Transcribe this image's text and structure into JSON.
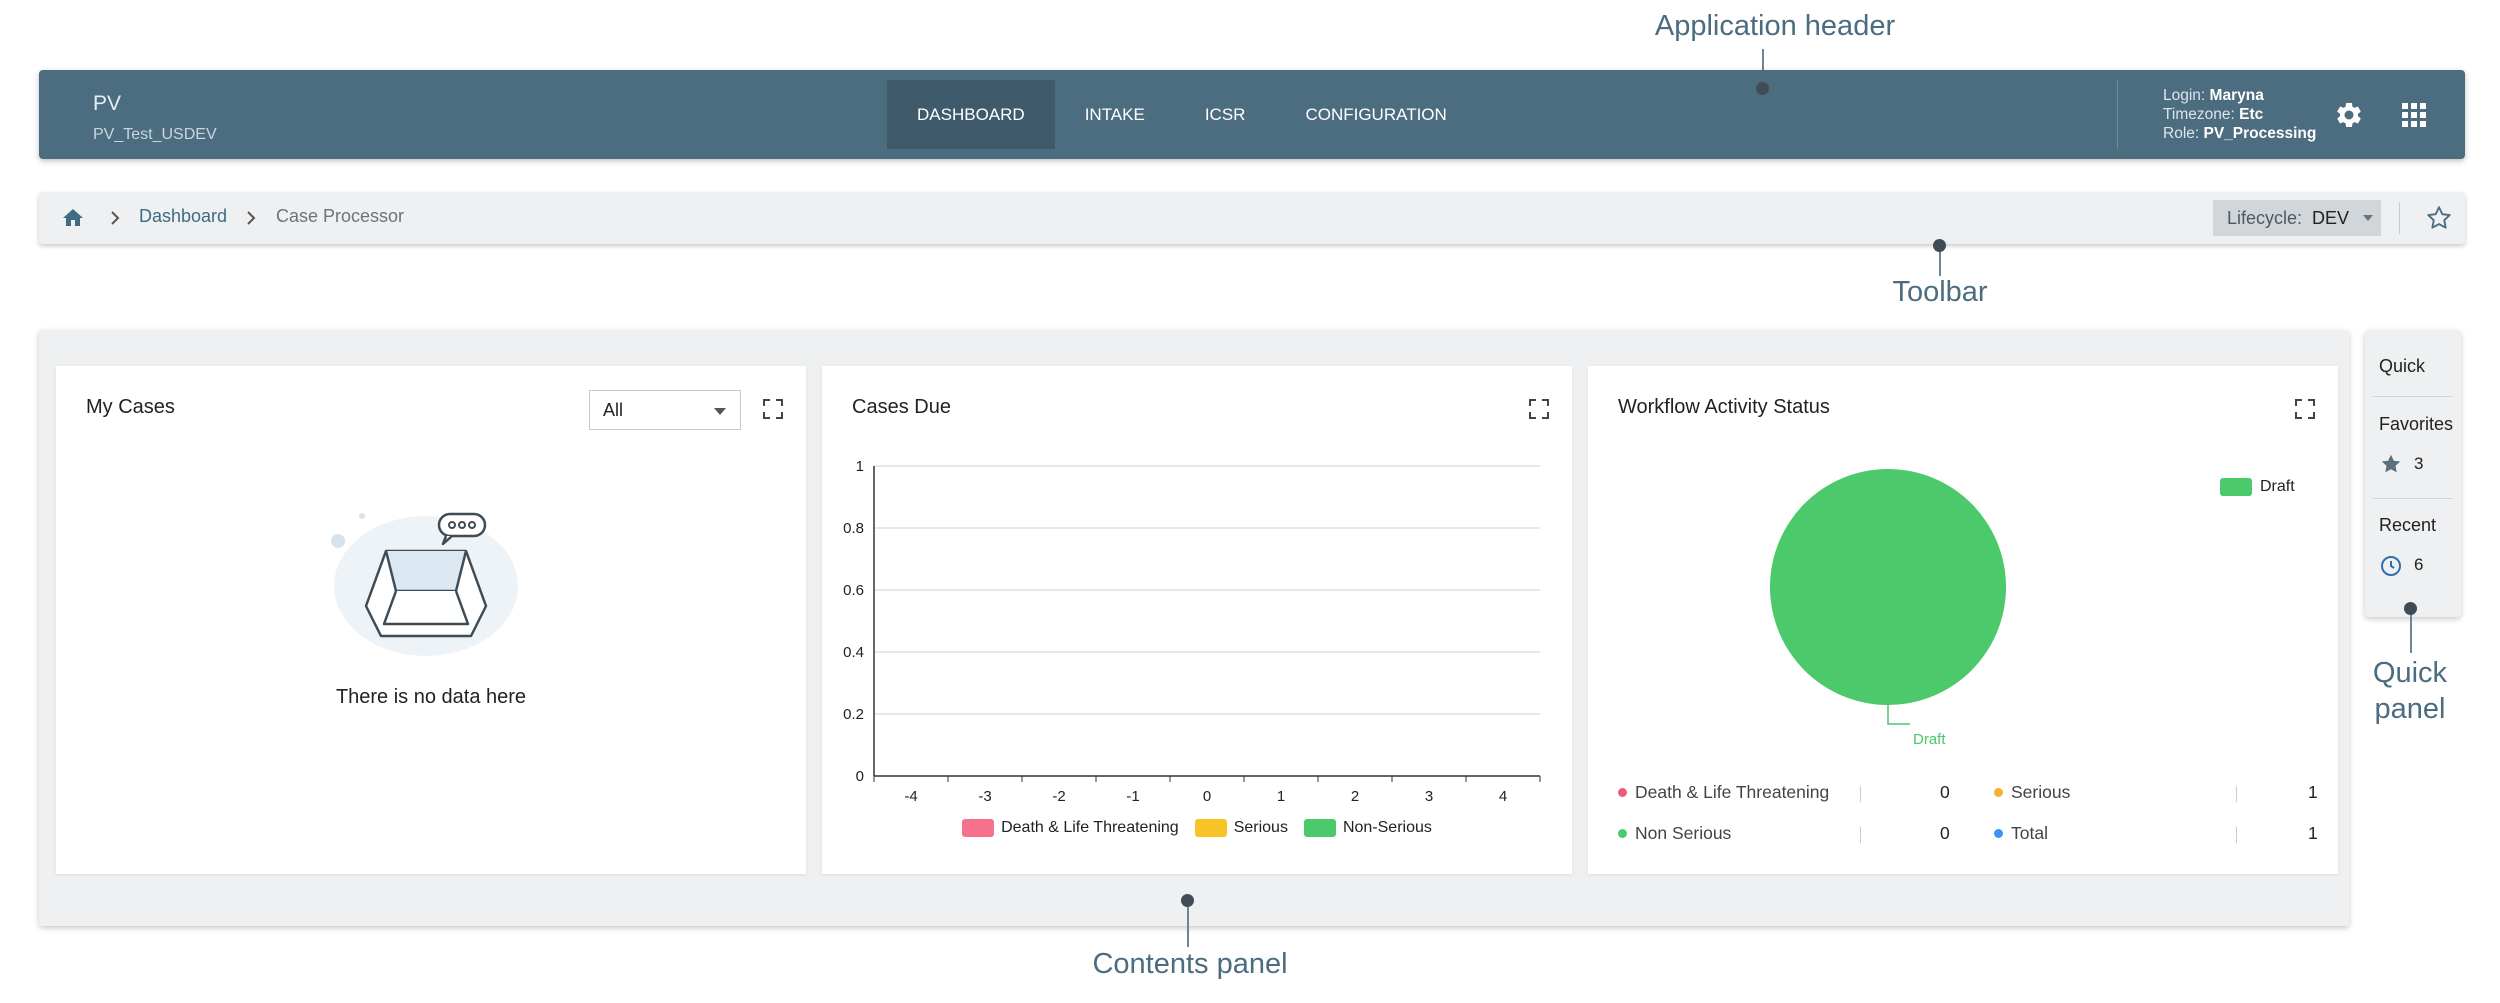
{
  "header": {
    "app_title": "PV",
    "app_subtitle": "PV_Test_USDEV",
    "nav_tabs": [
      {
        "label": "DASHBOARD",
        "active": true
      },
      {
        "label": "INTAKE",
        "active": false
      },
      {
        "label": "ICSR",
        "active": false
      },
      {
        "label": "CONFIGURATION",
        "active": false
      }
    ],
    "user": {
      "login_label": "Login:",
      "login_value": "Maryna",
      "timezone_label": "Timezone:",
      "timezone_value": "Etc",
      "role_label": "Role:",
      "role_value": "PV_Processing"
    },
    "icons": {
      "settings": "gear-icon",
      "apps": "grid-apps-icon"
    }
  },
  "toolbar": {
    "breadcrumbs": [
      {
        "label": "Dashboard",
        "link": true
      },
      {
        "label": "Case Processor",
        "link": false
      }
    ],
    "lifecycle_label": "Lifecycle:",
    "lifecycle_value": "DEV",
    "icons": {
      "home": "home-icon",
      "favorite": "star-outline-icon"
    }
  },
  "cards": {
    "my_cases": {
      "title": "My Cases",
      "filter_value": "All",
      "empty_text": "There is no data here"
    },
    "cases_due": {
      "title": "Cases Due"
    },
    "workflow": {
      "title": "Workflow Activity Status",
      "legend_label": "Draft",
      "pie_label": "Draft",
      "stats": [
        {
          "label": "Death & Life Threatening",
          "value": "0",
          "color": "#ef5a79"
        },
        {
          "label": "Serious",
          "value": "1",
          "color": "#f2b42a"
        },
        {
          "label": "Non Serious",
          "value": "0",
          "color": "#4bc96b"
        },
        {
          "label": "Total",
          "value": "1",
          "color": "#3b94f0"
        }
      ]
    }
  },
  "chart_data": [
    {
      "type": "bar",
      "title": "Cases Due",
      "x": [
        -4,
        -3,
        -2,
        -1,
        0,
        1,
        2,
        3,
        4
      ],
      "ylim": [
        0,
        1
      ],
      "yticks": [
        0,
        0.2,
        0.4,
        0.6,
        0.8,
        1
      ],
      "series": [
        {
          "name": "Death & Life Threatening",
          "color": "#f6718c",
          "values": [
            0,
            0,
            0,
            0,
            0,
            0,
            0,
            0,
            0
          ]
        },
        {
          "name": "Serious",
          "color": "#f7c326",
          "values": [
            0,
            0,
            0,
            0,
            0,
            0,
            0,
            0,
            0
          ]
        },
        {
          "name": "Non-Serious",
          "color": "#4bc96b",
          "values": [
            0,
            0,
            0,
            0,
            0,
            0,
            0,
            0,
            0
          ]
        }
      ],
      "grid": true,
      "legend": "bottom-center"
    },
    {
      "type": "pie",
      "title": "Workflow Activity Status",
      "slices": [
        {
          "label": "Draft",
          "value": 1,
          "color": "#4bc96b"
        }
      ],
      "legend": "top-right"
    }
  ],
  "quick_panel": {
    "quick_label": "Quick",
    "favorites_label": "Favorites",
    "favorites_count": "3",
    "recent_label": "Recent",
    "recent_count": "6",
    "icons": {
      "favorites": "star-icon",
      "recent": "clock-icon"
    }
  },
  "callouts": {
    "header": "Application header",
    "toolbar": "Toolbar",
    "quick_line1": "Quick",
    "quick_line2": "panel",
    "contents": "Contents panel"
  }
}
